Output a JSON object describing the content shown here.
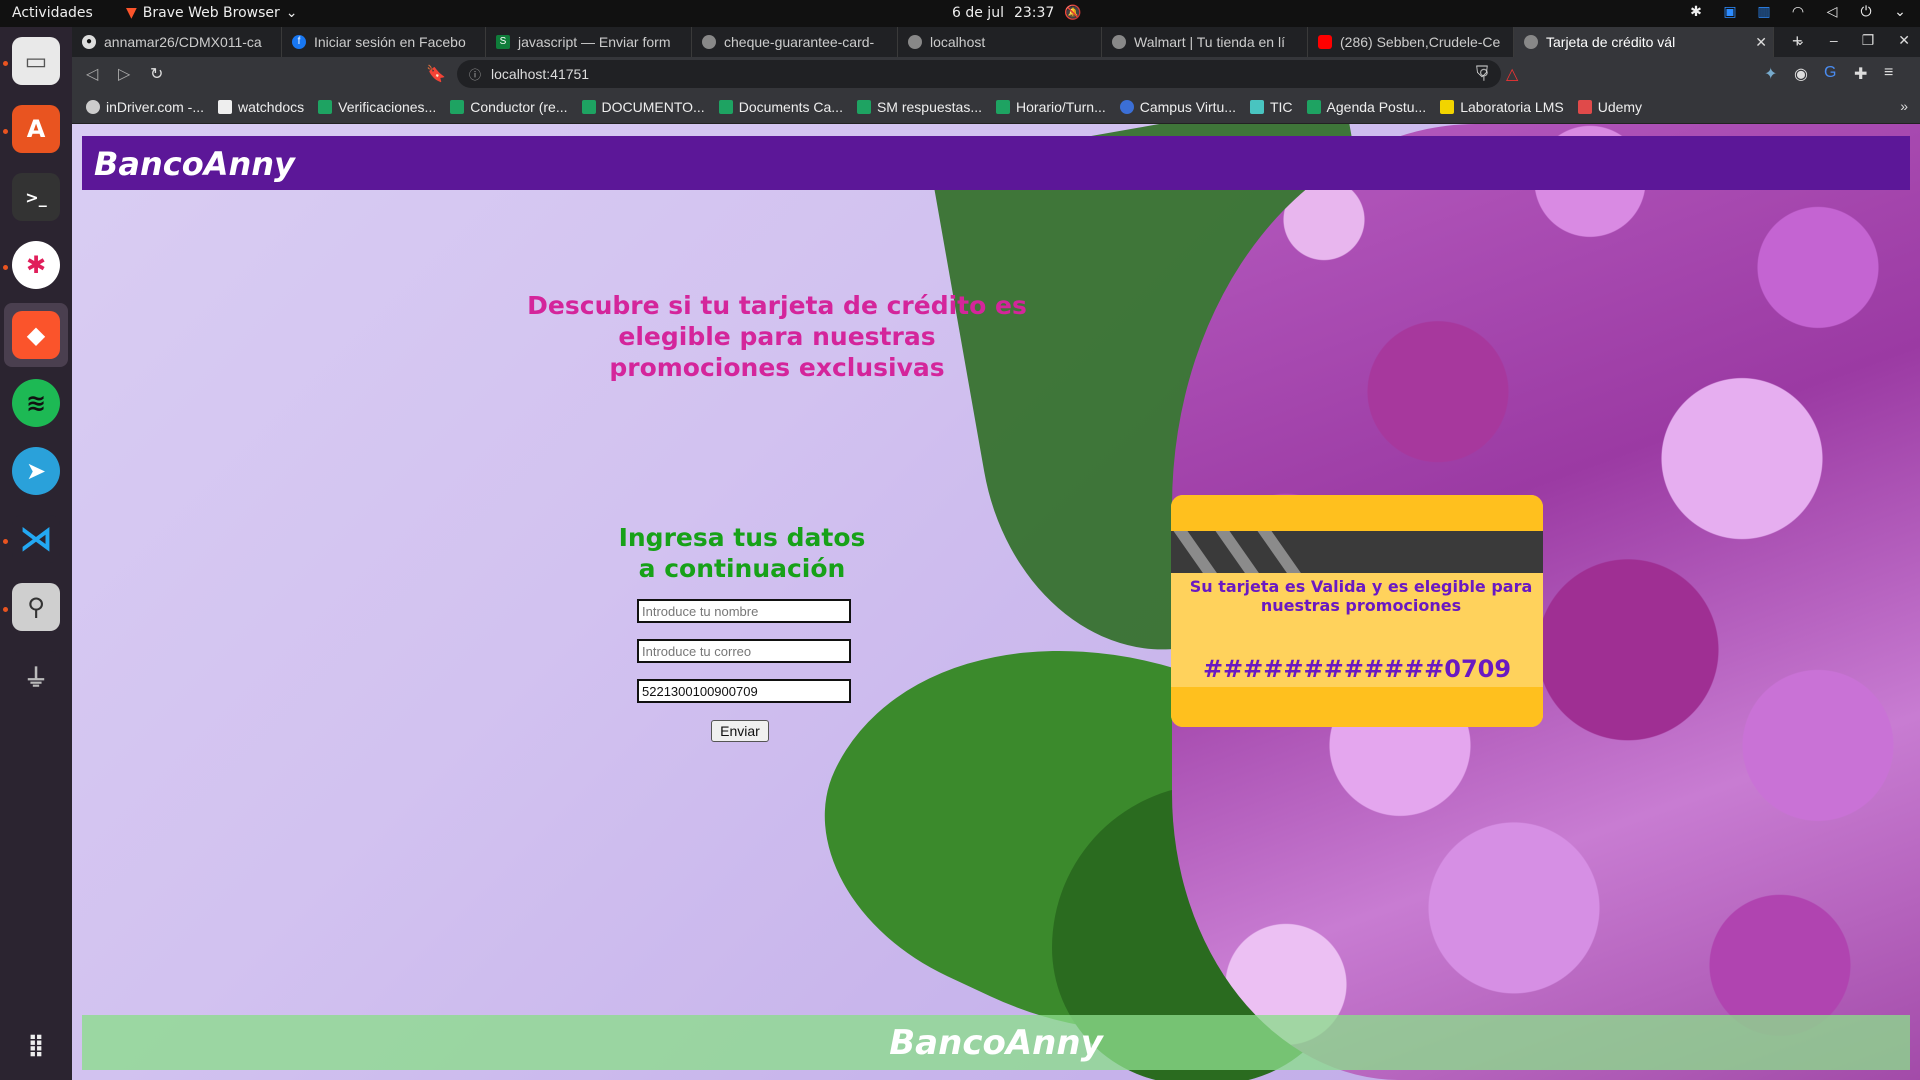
{
  "system": {
    "activities": "Actividades",
    "app_name": "Brave Web Browser",
    "date": "6 de jul",
    "time": "23:37"
  },
  "tabs": [
    {
      "title": "annamar26/CDMX011-ca",
      "icon": "github-icon"
    },
    {
      "title": "Iniciar sesión en Facebo",
      "icon": "facebook-icon"
    },
    {
      "title": "javascript — Enviar form",
      "icon": "stackoverflow-icon"
    },
    {
      "title": "cheque-guarantee-card-",
      "icon": "globe-icon"
    },
    {
      "title": "localhost",
      "icon": "globe-icon"
    },
    {
      "title": "Walmart | Tu tienda en lí",
      "icon": "globe-icon"
    },
    {
      "title": "(286) Sebben,Crudele-Ce",
      "icon": "youtube-icon"
    },
    {
      "title": "Tarjeta de crédito vál",
      "icon": "globe-icon",
      "active": true
    }
  ],
  "address": {
    "url": "localhost:41751"
  },
  "bookmarks": [
    {
      "label": "inDriver.com -...",
      "color": "#cccccc"
    },
    {
      "label": "watchdocs",
      "color": "#eeeeee"
    },
    {
      "label": "Verificaciones...",
      "color": "#1ea362"
    },
    {
      "label": "Conductor (re...",
      "color": "#1ea362"
    },
    {
      "label": "DOCUMENTO...",
      "color": "#1ea362"
    },
    {
      "label": "Documents Ca...",
      "color": "#1ea362"
    },
    {
      "label": "SM respuestas...",
      "color": "#1ea362"
    },
    {
      "label": "Horario/Turn...",
      "color": "#1ea362"
    },
    {
      "label": "Campus Virtu...",
      "color": "#3b6fd6"
    },
    {
      "label": "TIC",
      "color": "#49c4c0"
    },
    {
      "label": "Agenda Postu...",
      "color": "#1ea362"
    },
    {
      "label": "Laboratoria LMS",
      "color": "#f2d400"
    },
    {
      "label": "Udemy",
      "color": "#e04a4a"
    }
  ],
  "page": {
    "brand": "BancoAnny",
    "headline_lines": [
      "Descubre si tu tarjeta de crédito es",
      "elegible para nuestras",
      "promociones exclusivas"
    ],
    "form_title_lines": [
      "Ingresa tus datos",
      "a continuación"
    ],
    "name_placeholder": "Introduce tu nombre",
    "email_placeholder": "Introduce tu correo",
    "card_value": "5221300100900709",
    "submit_label": "Enviar",
    "card_message": "Su tarjeta es Valida y es elegible para nuestras promociones",
    "masked_number": "############0709",
    "footer_brand": "BancoAnny"
  },
  "colors": {
    "brand_bar": "#5c1798",
    "headline": "#d4259b",
    "form_title": "#17a118",
    "card": "#ffd25c",
    "card_text": "#6a19c2"
  }
}
